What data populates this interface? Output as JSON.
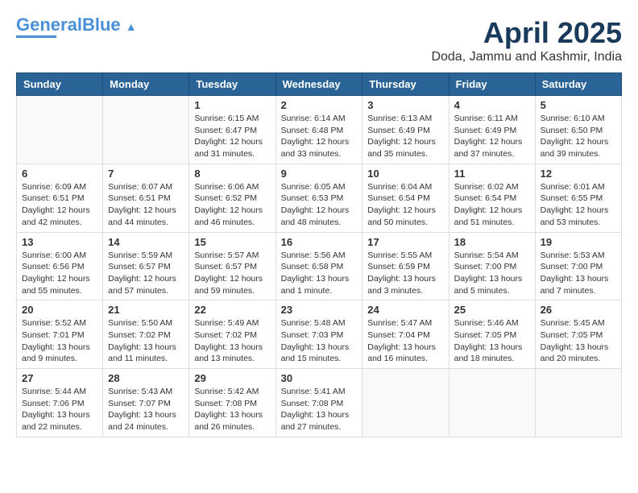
{
  "header": {
    "logo_general": "General",
    "logo_blue": "Blue",
    "month": "April 2025",
    "location": "Doda, Jammu and Kashmir, India"
  },
  "days_of_week": [
    "Sunday",
    "Monday",
    "Tuesday",
    "Wednesday",
    "Thursday",
    "Friday",
    "Saturday"
  ],
  "weeks": [
    [
      {
        "day": "",
        "text": ""
      },
      {
        "day": "",
        "text": ""
      },
      {
        "day": "1",
        "text": "Sunrise: 6:15 AM\nSunset: 6:47 PM\nDaylight: 12 hours\nand 31 minutes."
      },
      {
        "day": "2",
        "text": "Sunrise: 6:14 AM\nSunset: 6:48 PM\nDaylight: 12 hours\nand 33 minutes."
      },
      {
        "day": "3",
        "text": "Sunrise: 6:13 AM\nSunset: 6:49 PM\nDaylight: 12 hours\nand 35 minutes."
      },
      {
        "day": "4",
        "text": "Sunrise: 6:11 AM\nSunset: 6:49 PM\nDaylight: 12 hours\nand 37 minutes."
      },
      {
        "day": "5",
        "text": "Sunrise: 6:10 AM\nSunset: 6:50 PM\nDaylight: 12 hours\nand 39 minutes."
      }
    ],
    [
      {
        "day": "6",
        "text": "Sunrise: 6:09 AM\nSunset: 6:51 PM\nDaylight: 12 hours\nand 42 minutes."
      },
      {
        "day": "7",
        "text": "Sunrise: 6:07 AM\nSunset: 6:51 PM\nDaylight: 12 hours\nand 44 minutes."
      },
      {
        "day": "8",
        "text": "Sunrise: 6:06 AM\nSunset: 6:52 PM\nDaylight: 12 hours\nand 46 minutes."
      },
      {
        "day": "9",
        "text": "Sunrise: 6:05 AM\nSunset: 6:53 PM\nDaylight: 12 hours\nand 48 minutes."
      },
      {
        "day": "10",
        "text": "Sunrise: 6:04 AM\nSunset: 6:54 PM\nDaylight: 12 hours\nand 50 minutes."
      },
      {
        "day": "11",
        "text": "Sunrise: 6:02 AM\nSunset: 6:54 PM\nDaylight: 12 hours\nand 51 minutes."
      },
      {
        "day": "12",
        "text": "Sunrise: 6:01 AM\nSunset: 6:55 PM\nDaylight: 12 hours\nand 53 minutes."
      }
    ],
    [
      {
        "day": "13",
        "text": "Sunrise: 6:00 AM\nSunset: 6:56 PM\nDaylight: 12 hours\nand 55 minutes."
      },
      {
        "day": "14",
        "text": "Sunrise: 5:59 AM\nSunset: 6:57 PM\nDaylight: 12 hours\nand 57 minutes."
      },
      {
        "day": "15",
        "text": "Sunrise: 5:57 AM\nSunset: 6:57 PM\nDaylight: 12 hours\nand 59 minutes."
      },
      {
        "day": "16",
        "text": "Sunrise: 5:56 AM\nSunset: 6:58 PM\nDaylight: 13 hours\nand 1 minute."
      },
      {
        "day": "17",
        "text": "Sunrise: 5:55 AM\nSunset: 6:59 PM\nDaylight: 13 hours\nand 3 minutes."
      },
      {
        "day": "18",
        "text": "Sunrise: 5:54 AM\nSunset: 7:00 PM\nDaylight: 13 hours\nand 5 minutes."
      },
      {
        "day": "19",
        "text": "Sunrise: 5:53 AM\nSunset: 7:00 PM\nDaylight: 13 hours\nand 7 minutes."
      }
    ],
    [
      {
        "day": "20",
        "text": "Sunrise: 5:52 AM\nSunset: 7:01 PM\nDaylight: 13 hours\nand 9 minutes."
      },
      {
        "day": "21",
        "text": "Sunrise: 5:50 AM\nSunset: 7:02 PM\nDaylight: 13 hours\nand 11 minutes."
      },
      {
        "day": "22",
        "text": "Sunrise: 5:49 AM\nSunset: 7:02 PM\nDaylight: 13 hours\nand 13 minutes."
      },
      {
        "day": "23",
        "text": "Sunrise: 5:48 AM\nSunset: 7:03 PM\nDaylight: 13 hours\nand 15 minutes."
      },
      {
        "day": "24",
        "text": "Sunrise: 5:47 AM\nSunset: 7:04 PM\nDaylight: 13 hours\nand 16 minutes."
      },
      {
        "day": "25",
        "text": "Sunrise: 5:46 AM\nSunset: 7:05 PM\nDaylight: 13 hours\nand 18 minutes."
      },
      {
        "day": "26",
        "text": "Sunrise: 5:45 AM\nSunset: 7:05 PM\nDaylight: 13 hours\nand 20 minutes."
      }
    ],
    [
      {
        "day": "27",
        "text": "Sunrise: 5:44 AM\nSunset: 7:06 PM\nDaylight: 13 hours\nand 22 minutes."
      },
      {
        "day": "28",
        "text": "Sunrise: 5:43 AM\nSunset: 7:07 PM\nDaylight: 13 hours\nand 24 minutes."
      },
      {
        "day": "29",
        "text": "Sunrise: 5:42 AM\nSunset: 7:08 PM\nDaylight: 13 hours\nand 26 minutes."
      },
      {
        "day": "30",
        "text": "Sunrise: 5:41 AM\nSunset: 7:08 PM\nDaylight: 13 hours\nand 27 minutes."
      },
      {
        "day": "",
        "text": ""
      },
      {
        "day": "",
        "text": ""
      },
      {
        "day": "",
        "text": ""
      }
    ]
  ]
}
